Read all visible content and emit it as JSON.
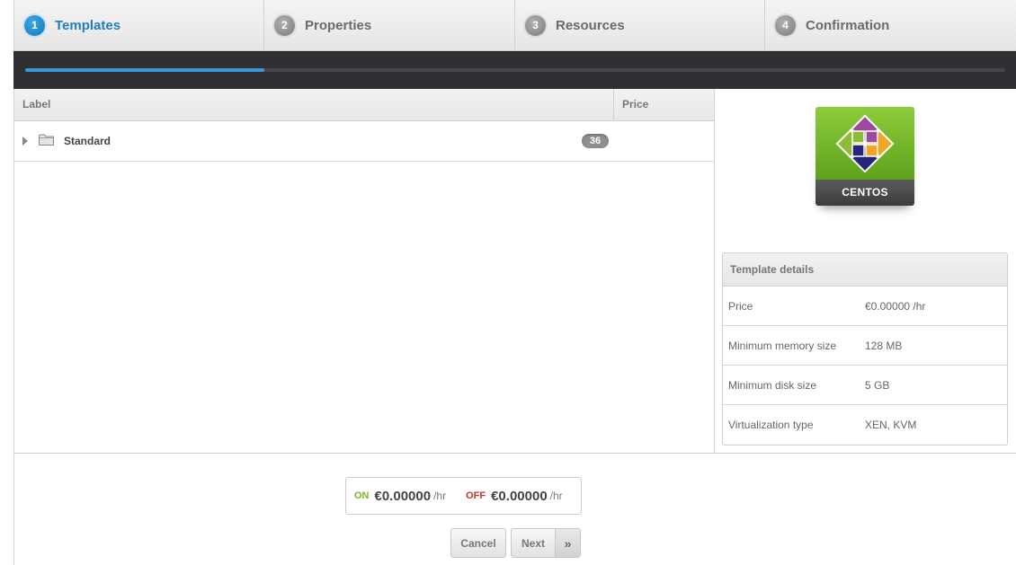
{
  "steps": [
    {
      "number": "1",
      "label": "Templates",
      "active": true
    },
    {
      "number": "2",
      "label": "Properties",
      "active": false
    },
    {
      "number": "3",
      "label": "Resources",
      "active": false
    },
    {
      "number": "4",
      "label": "Confirmation",
      "active": false
    }
  ],
  "progress": {
    "fraction": 0.244,
    "color": "#3b98dc"
  },
  "table": {
    "headers": {
      "label": "Label",
      "price": "Price"
    },
    "rows": [
      {
        "name": "Standard",
        "count": "36",
        "price": "",
        "icon": "folder-icon",
        "expander": "triangle-right-icon"
      }
    ]
  },
  "template": {
    "logo_text": "CENTOS",
    "details_title": "Template details",
    "details": [
      {
        "key": "Price",
        "value": "€0.00000 /hr"
      },
      {
        "key": "Minimum memory size",
        "value": "128 MB"
      },
      {
        "key": "Minimum disk size",
        "value": "5 GB"
      },
      {
        "key": "Virtualization type",
        "value": "XEN, KVM"
      }
    ]
  },
  "pricing": {
    "on_label": "ON",
    "on_amount": "€0.00000",
    "on_unit": "/hr",
    "off_label": "OFF",
    "off_amount": "€0.00000",
    "off_unit": "/hr"
  },
  "buttons": {
    "cancel": "Cancel",
    "next": "Next",
    "next_icon": "»"
  },
  "colors": {
    "accent": "#1f7fbd",
    "on": "#7fb42a",
    "off": "#c0392b",
    "logo_green": "#72b62a"
  }
}
